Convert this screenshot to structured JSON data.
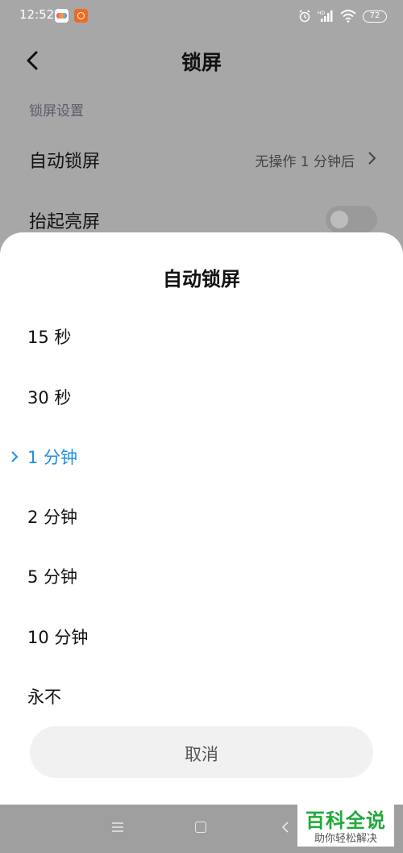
{
  "status_bar": {
    "time": "12:52",
    "battery": "72"
  },
  "header": {
    "title": "锁屏"
  },
  "settings": {
    "section_label": "锁屏设置",
    "auto_lock": {
      "label": "自动锁屏",
      "value": "无操作 1 分钟后"
    },
    "raise_to_wake": {
      "label": "抬起亮屏",
      "enabled": false
    }
  },
  "sheet": {
    "title": "自动锁屏",
    "options": [
      {
        "label": "15 秒",
        "selected": false
      },
      {
        "label": "30 秒",
        "selected": false
      },
      {
        "label": "1 分钟",
        "selected": true
      },
      {
        "label": "2 分钟",
        "selected": false
      },
      {
        "label": "5 分钟",
        "selected": false
      },
      {
        "label": "10 分钟",
        "selected": false
      },
      {
        "label": "永不",
        "selected": false
      }
    ],
    "cancel_label": "取消"
  },
  "watermark": {
    "title": "百科全说",
    "subtitle": "助你轻松解决"
  },
  "colors": {
    "accent": "#1e8ee6",
    "dim_overlay": "#a7a7a7",
    "watermark_green": "#1faa3a"
  }
}
